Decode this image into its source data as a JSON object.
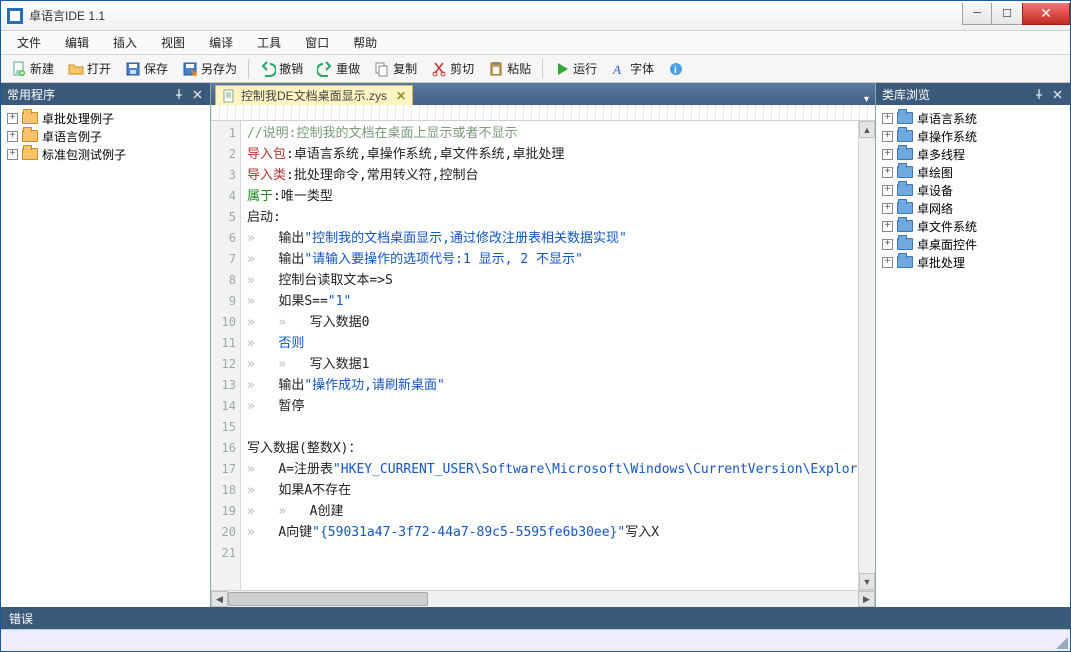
{
  "title": "卓语言IDE 1.1",
  "menus": [
    "文件",
    "编辑",
    "插入",
    "视图",
    "编译",
    "工具",
    "窗口",
    "帮助"
  ],
  "toolbar": {
    "new": "新建",
    "open": "打开",
    "save": "保存",
    "saveas": "另存为",
    "undo": "撤销",
    "redo": "重做",
    "copy": "复制",
    "cut": "剪切",
    "paste": "粘贴",
    "run": "运行",
    "font": "字体"
  },
  "leftPanel": {
    "title": "常用程序",
    "items": [
      "卓批处理例子",
      "卓语言例子",
      "标准包测试例子"
    ]
  },
  "rightPanel": {
    "title": "类库浏览",
    "items": [
      "卓语言系统",
      "卓操作系统",
      "卓多线程",
      "卓绘图",
      "卓设备",
      "卓网络",
      "卓文件系统",
      "卓桌面控件",
      "卓批处理"
    ]
  },
  "tab": {
    "filename": "控制我DE文档桌面显示.zys"
  },
  "errorTab": "错误",
  "code": {
    "lines": [
      {
        "n": 1,
        "segs": [
          {
            "t": "//说明:控制我的文档在桌面上显示或者不显示",
            "c": "cmt"
          }
        ]
      },
      {
        "n": 2,
        "segs": [
          {
            "t": "导入包",
            "c": "kw"
          },
          {
            "t": ":卓语言系统,卓操作系统,卓文件系统,卓批处理"
          }
        ]
      },
      {
        "n": 3,
        "segs": [
          {
            "t": "导入类",
            "c": "kw"
          },
          {
            "t": ":批处理命令,常用转义符,控制台"
          }
        ]
      },
      {
        "n": 4,
        "segs": [
          {
            "t": "属于",
            "c": "kw2"
          },
          {
            "t": ":唯一类型"
          }
        ]
      },
      {
        "n": 5,
        "segs": [
          {
            "t": "启动:"
          }
        ]
      },
      {
        "n": 6,
        "indent": 1,
        "segs": [
          {
            "t": "输出"
          },
          {
            "t": "\"控制我的文档桌面显示,通过修改注册表相关数据实现\"",
            "c": "str"
          }
        ]
      },
      {
        "n": 7,
        "indent": 1,
        "segs": [
          {
            "t": "输出"
          },
          {
            "t": "\"请输入要操作的选项代号:1 显示, 2 不显示\"",
            "c": "str"
          }
        ]
      },
      {
        "n": 8,
        "indent": 1,
        "segs": [
          {
            "t": "控制台读取文本=>S"
          }
        ]
      },
      {
        "n": 9,
        "indent": 1,
        "segs": [
          {
            "t": "如果S=="
          },
          {
            "t": "\"1\"",
            "c": "str"
          }
        ]
      },
      {
        "n": 10,
        "indent": 2,
        "segs": [
          {
            "t": "写入数据0"
          }
        ]
      },
      {
        "n": 11,
        "indent": 1,
        "segs": [
          {
            "t": "否则",
            "c": "kw3"
          }
        ]
      },
      {
        "n": 12,
        "indent": 2,
        "segs": [
          {
            "t": "写入数据1"
          }
        ]
      },
      {
        "n": 13,
        "indent": 1,
        "segs": [
          {
            "t": "输出"
          },
          {
            "t": "\"操作成功,请刷新桌面\"",
            "c": "str"
          }
        ]
      },
      {
        "n": 14,
        "indent": 1,
        "segs": [
          {
            "t": "暂停"
          }
        ]
      },
      {
        "n": 15,
        "segs": []
      },
      {
        "n": 16,
        "segs": [
          {
            "t": "写入数据(整数X)："
          }
        ]
      },
      {
        "n": 17,
        "indent": 1,
        "segs": [
          {
            "t": "A=注册表"
          },
          {
            "t": "\"HKEY_CURRENT_USER\\Software\\Microsoft\\Windows\\CurrentVersion\\Explorer\\H",
            "c": "str"
          }
        ]
      },
      {
        "n": 18,
        "indent": 1,
        "segs": [
          {
            "t": "如果A不存在"
          }
        ]
      },
      {
        "n": 19,
        "indent": 2,
        "segs": [
          {
            "t": "A创建"
          }
        ]
      },
      {
        "n": 20,
        "indent": 1,
        "segs": [
          {
            "t": "A向键"
          },
          {
            "t": "\"{59031a47-3f72-44a7-89c5-5595fe6b30ee}\"",
            "c": "str"
          },
          {
            "t": "写入X"
          }
        ]
      },
      {
        "n": 21,
        "segs": []
      }
    ]
  }
}
